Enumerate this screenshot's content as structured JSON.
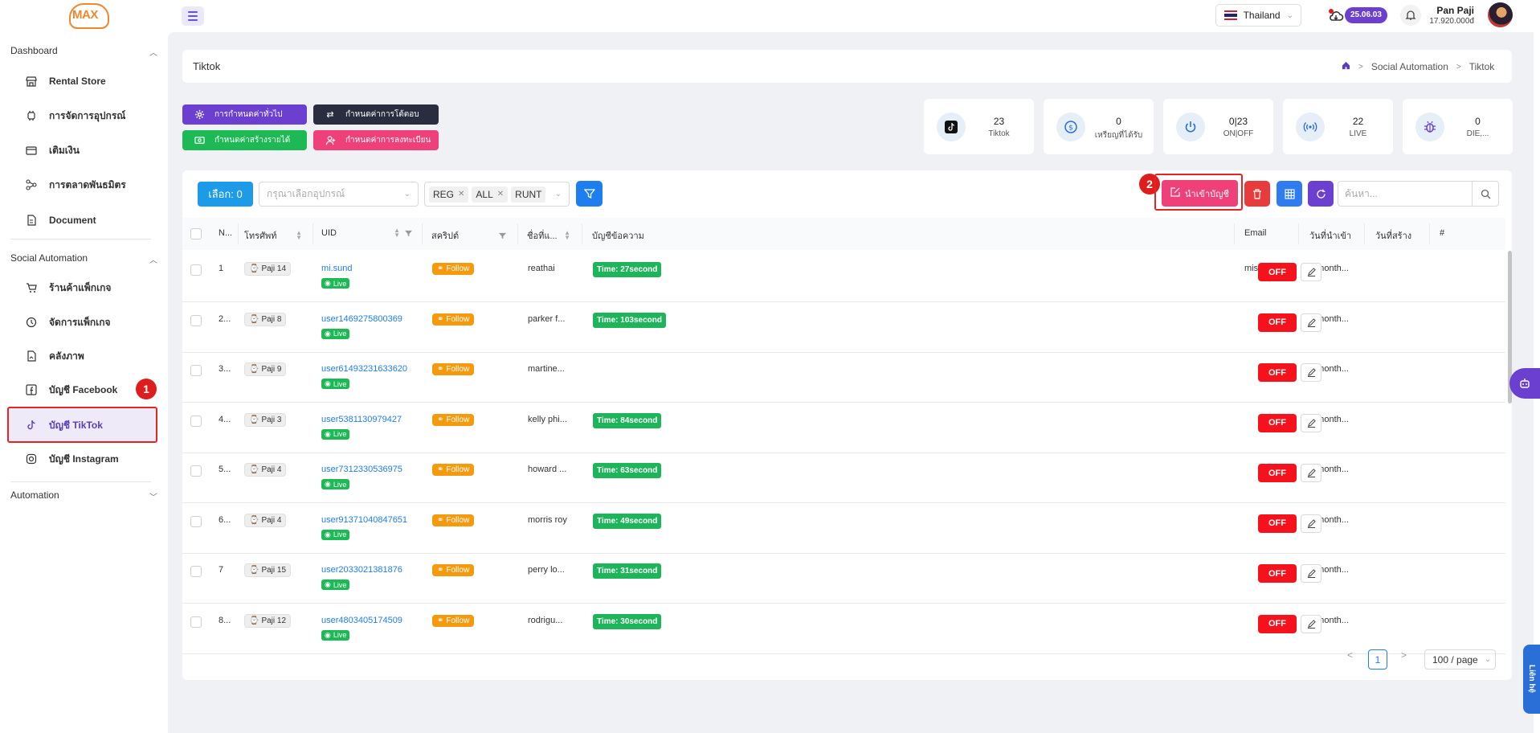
{
  "header": {
    "logo_text": "MAX",
    "country": "Thailand",
    "version": "25.06.03",
    "user_name": "Pan Paji",
    "user_balance": "17.920.000đ"
  },
  "sidebar": {
    "sections": [
      {
        "label": "Dashboard"
      },
      {
        "label": "Social Automation"
      },
      {
        "label": "Automation"
      }
    ],
    "dashboard_items": [
      {
        "label": "Rental Store",
        "icon": "store-icon"
      },
      {
        "label": "การจัดการอุปกรณ์",
        "icon": "device-icon"
      },
      {
        "label": "เติมเงิน",
        "icon": "wallet-icon"
      },
      {
        "label": "การตลาดพันธมิตร",
        "icon": "network-icon"
      },
      {
        "label": "Document",
        "icon": "document-icon"
      }
    ],
    "social_items": [
      {
        "label": "ร้านค้าแพ็กเกจ",
        "icon": "cart-icon"
      },
      {
        "label": "จัดการแพ็กเกจ",
        "icon": "clock-icon"
      },
      {
        "label": "คลังภาพ",
        "icon": "image-file-icon"
      },
      {
        "label": "บัญชี Facebook",
        "icon": "facebook-icon"
      },
      {
        "label": "บัญชี TikTok",
        "icon": "tiktok-icon"
      },
      {
        "label": "บัญชี Instagram",
        "icon": "instagram-icon"
      }
    ]
  },
  "annotations": {
    "marker_1": "1",
    "marker_2": "2"
  },
  "page": {
    "title": "Tiktok",
    "breadcrumb": [
      "Social Automation",
      "Tiktok"
    ]
  },
  "actions": {
    "general_settings": "การกำหนดค่าทั่วไป",
    "interaction_settings": "กำหนดค่าการโต้ตอบ",
    "income_settings": "กำหนดค่าสร้างรายได้",
    "register_settings": "กำหนดค่าการลงทะเบียน"
  },
  "stats": [
    {
      "value": "23",
      "label": "Tiktok",
      "icon": "tiktok-icon"
    },
    {
      "value": "0",
      "label": "เหรียญที่ได้รับ",
      "icon": "coin-icon"
    },
    {
      "value": "0|23",
      "label": "ON|OFF",
      "icon": "power-icon"
    },
    {
      "value": "22",
      "label": "LIVE",
      "icon": "broadcast-icon"
    },
    {
      "value": "0",
      "label": "DIE,...",
      "icon": "bug-icon"
    }
  ],
  "toolbar": {
    "selected_label": "เลือก: 0",
    "device_placeholder": "กรุณาเลือกอุปกรณ์",
    "tags": [
      "REG",
      "ALL",
      "RUNT"
    ],
    "import_label": "นำเข้าบัญชี",
    "search_placeholder": "ค้นหา..."
  },
  "table": {
    "columns": [
      "N...",
      "โทรศัพท์",
      "UID",
      "สคริปต์",
      "ชื่อที่แ...",
      "บัญชีข้อความ",
      "Email",
      "วันที่นำเข้า",
      "วันที่สร้าง",
      "#"
    ],
    "rows": [
      {
        "n": "1",
        "phone": "Paji 14",
        "uid": "mi.sund",
        "status": "Live",
        "script": "Follow",
        "name": "reathai",
        "time": "Time: 27second",
        "email": "misund...",
        "imported": "5 month...",
        "toggle": "OFF"
      },
      {
        "n": "2...",
        "phone": "Paji 8",
        "uid": "user1469275800369",
        "status": "Live",
        "script": "Follow",
        "name": "parker f...",
        "time": "Time: 103second",
        "email": "",
        "imported": "7 month...",
        "toggle": "OFF"
      },
      {
        "n": "3...",
        "phone": "Paji 9",
        "uid": "user61493231633620",
        "status": "Live",
        "script": "Follow",
        "name": "martine...",
        "time": "",
        "email": "",
        "imported": "7 month...",
        "toggle": "OFF"
      },
      {
        "n": "4...",
        "phone": "Paji 3",
        "uid": "user5381130979427",
        "status": "Live",
        "script": "Follow",
        "name": "kelly phi...",
        "time": "Time: 84second",
        "email": "",
        "imported": "7 month...",
        "toggle": "OFF"
      },
      {
        "n": "5...",
        "phone": "Paji 4",
        "uid": "user7312330536975",
        "status": "Live",
        "script": "Follow",
        "name": "howard ...",
        "time": "Time: 63second",
        "email": "",
        "imported": "7 month...",
        "toggle": "OFF"
      },
      {
        "n": "6...",
        "phone": "Paji 4",
        "uid": "user91371040847651",
        "status": "Live",
        "script": "Follow",
        "name": "morris roy",
        "time": "Time: 49second",
        "email": "",
        "imported": "7 month...",
        "toggle": "OFF"
      },
      {
        "n": "7",
        "phone": "Paji 15",
        "uid": "user2033021381876",
        "status": "Live",
        "script": "Follow",
        "name": "perry lo...",
        "time": "Time: 31second",
        "email": "",
        "imported": "7 month...",
        "toggle": "OFF"
      },
      {
        "n": "8...",
        "phone": "Paji 12",
        "uid": "user4803405174509",
        "status": "Live",
        "script": "Follow",
        "name": "rodrigu...",
        "time": "Time: 30second",
        "email": "",
        "imported": "7 month...",
        "toggle": "OFF"
      }
    ]
  },
  "pagination": {
    "current": "1",
    "per_page": "100 / page"
  },
  "contact_label": "Liên hệ",
  "colors": {
    "accent": "#6b3fd0",
    "primary_blue": "#1e7ef0",
    "danger": "#f5121c",
    "pink": "#f0407a"
  }
}
